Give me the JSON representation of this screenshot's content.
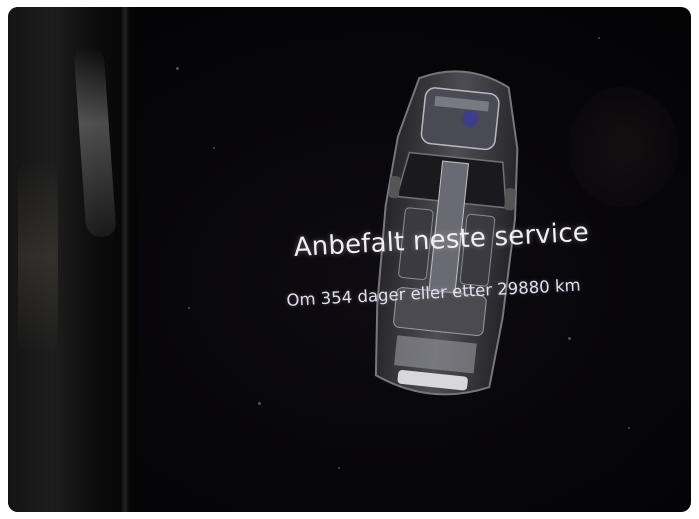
{
  "service": {
    "title": "Anbefalt neste service",
    "subtitle": "Om 354 dager eller etter 29880 km"
  },
  "icons": {
    "car": "car-xray-icon"
  },
  "colors": {
    "screen_bg": "#060508",
    "text": "#f2eef8",
    "frame": "#ffffff"
  }
}
